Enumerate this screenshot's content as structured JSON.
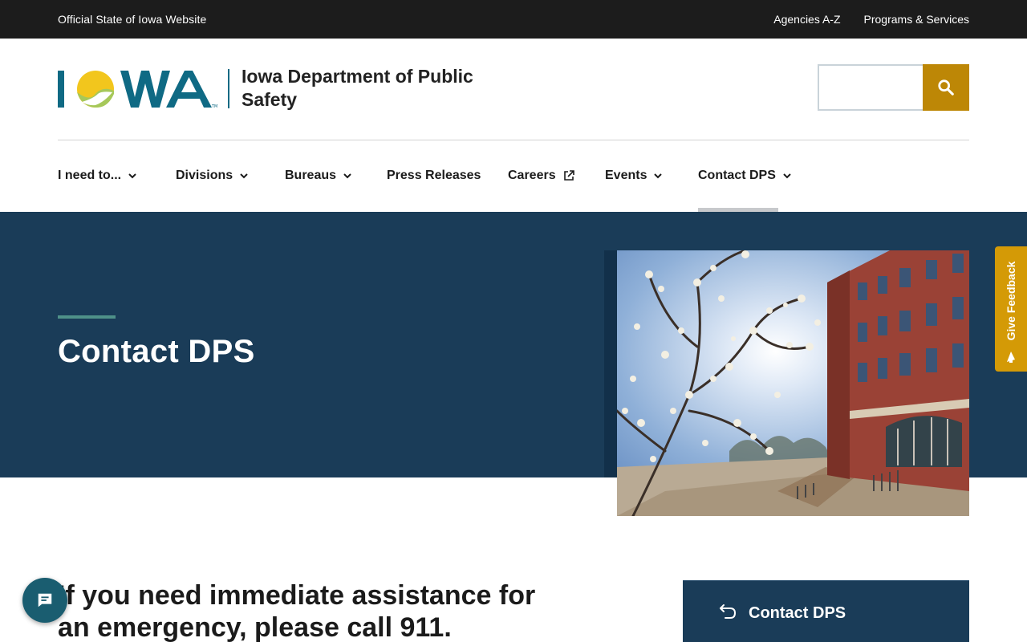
{
  "utility": {
    "official_label": "Official State of Iowa Website",
    "links": [
      "Agencies A-Z",
      "Programs & Services"
    ]
  },
  "header": {
    "logo_text": "IOWA",
    "department": "Iowa Department of Public Safety",
    "search": {
      "placeholder": "",
      "button_icon": "search-icon"
    }
  },
  "nav": {
    "items": [
      {
        "label": "I need to...",
        "icon": "chevron-down-icon"
      },
      {
        "label": "Divisions",
        "icon": "chevron-down-icon"
      },
      {
        "label": "Bureaus",
        "icon": "chevron-down-icon"
      },
      {
        "label": "Press Releases",
        "icon": ""
      },
      {
        "label": "Careers",
        "icon": "external-link-icon"
      },
      {
        "label": "Events",
        "icon": "chevron-down-icon"
      },
      {
        "label": "Contact DPS",
        "icon": "chevron-down-icon"
      }
    ],
    "active": "Contact DPS"
  },
  "hero": {
    "title": "Contact DPS",
    "image_alt": "Flowering tree in front of a red brick building"
  },
  "feedback": {
    "label": "Give Feedback"
  },
  "main": {
    "emergency_text": "If you need immediate assistance for an emergency, please call 911."
  },
  "side_nav": {
    "label": "Contact DPS"
  },
  "colors": {
    "utility_bg": "#1c1c1c",
    "hero_bg": "#1a3c58",
    "accent_gold": "#bd8706",
    "feedback_gold": "#d49a06",
    "accent_teal": "#4f9189",
    "logo_blue": "#0f6a84"
  }
}
